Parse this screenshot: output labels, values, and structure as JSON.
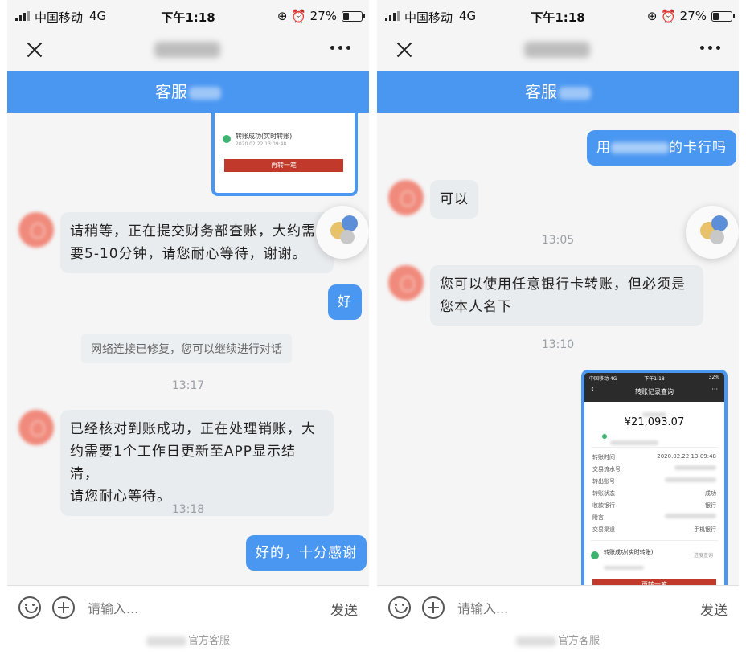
{
  "status_bar": {
    "carrier": "中国移动",
    "network": "4G",
    "time": "下午1:18",
    "battery": "27%"
  },
  "service_bar": {
    "label": "客服"
  },
  "input_bar": {
    "placeholder": "请输入...",
    "send_label": "发送"
  },
  "footer": {
    "label": "官方客服"
  },
  "left_chat": {
    "screenshot_fragment": {
      "status_text": "转账成功(实时转账)",
      "date": "2020.02.22 13:09:48",
      "button": "再转一笔"
    },
    "msg1": {
      "line1": "请稍等，正在提交财务部查账，大约需",
      "line2": "要5-10分钟，请您耐心等待，谢谢。"
    },
    "reply1": "好",
    "system_notice": "网络连接已修复，您可以继续进行对话",
    "time1": "13:17",
    "msg2": {
      "line1": "已经核对到账成功，正在处理销账，大",
      "line2": "约需要1个工作日更新至APP显示结清，",
      "line3": "请您耐心等待。"
    },
    "time2": "13:18",
    "reply2": "好的，十分感谢"
  },
  "right_chat": {
    "question": {
      "prefix": "用",
      "suffix": "的卡行吗"
    },
    "msg1": "可以",
    "time1": "13:05",
    "msg2": {
      "line1": "您可以使用任意银行卡转账，但必须是",
      "line2": "您本人名下"
    },
    "time2": "13:10",
    "screenshot": {
      "status_carrier": "中国移动 4G",
      "status_time": "下午1:18",
      "status_battery": "32%",
      "title": "转账记录查询",
      "amount": "¥21,093.07",
      "rows": [
        {
          "label": "转账时间",
          "value": "2020.02.22 13:09:48"
        },
        {
          "label": "交易流水号",
          "value": ""
        },
        {
          "label": "转出账号",
          "value": ""
        },
        {
          "label": "转账状态",
          "value": "成功"
        },
        {
          "label": "收款银行",
          "value": "银行"
        },
        {
          "label": "附言",
          "value": ""
        },
        {
          "label": "交易渠道",
          "value": "手机银行"
        }
      ],
      "result_status": "转账成功(实时转账)",
      "result_link": "进度查询",
      "button": "再转一笔"
    }
  }
}
